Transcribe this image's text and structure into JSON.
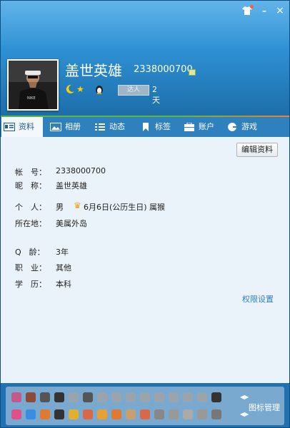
{
  "header": {
    "nickname": "盖世英雄",
    "qq_number": "2338000700",
    "talent_badge": "达人",
    "days": "2天"
  },
  "window_controls": {
    "skin": "tshirt-icon",
    "minimize": "–",
    "close": "×"
  },
  "tabs": [
    {
      "label": "资料",
      "icon": "profile-card-icon",
      "active": true
    },
    {
      "label": "相册",
      "icon": "album-icon",
      "active": false
    },
    {
      "label": "动态",
      "icon": "feed-icon",
      "active": false
    },
    {
      "label": "标签",
      "icon": "bookmark-icon",
      "active": false
    },
    {
      "label": "账户",
      "icon": "wallet-icon",
      "active": false
    },
    {
      "label": "游戏",
      "icon": "game-icon",
      "active": false
    }
  ],
  "profile": {
    "edit_button": "编辑资料",
    "fields": [
      {
        "label": "帐　号：",
        "value": "2338000700"
      },
      {
        "label": "昵　称：",
        "value": "盖世英雄"
      },
      {
        "label": "个　人：",
        "value": "男",
        "birthday": "6月6日(公历生日)",
        "zodiac": "属猴"
      },
      {
        "label": "所在地：",
        "value": "美属外岛"
      },
      {
        "label": "Q　龄：",
        "value": "3年"
      },
      {
        "label": "职　业：",
        "value": "其他"
      },
      {
        "label": "学　历：",
        "value": "本科"
      }
    ],
    "permission_link": "权限设置"
  },
  "icon_bar": {
    "manage_label": "图标管理"
  },
  "colors": {
    "header_top": "#3fa3e4",
    "header_bottom": "#1d6ea9",
    "tabbar": "#2e81bd",
    "content_bg": "#eaf3f9",
    "link": "#2f7ec6",
    "green_line": "#5ab843",
    "orange_line": "#f07f2e"
  }
}
